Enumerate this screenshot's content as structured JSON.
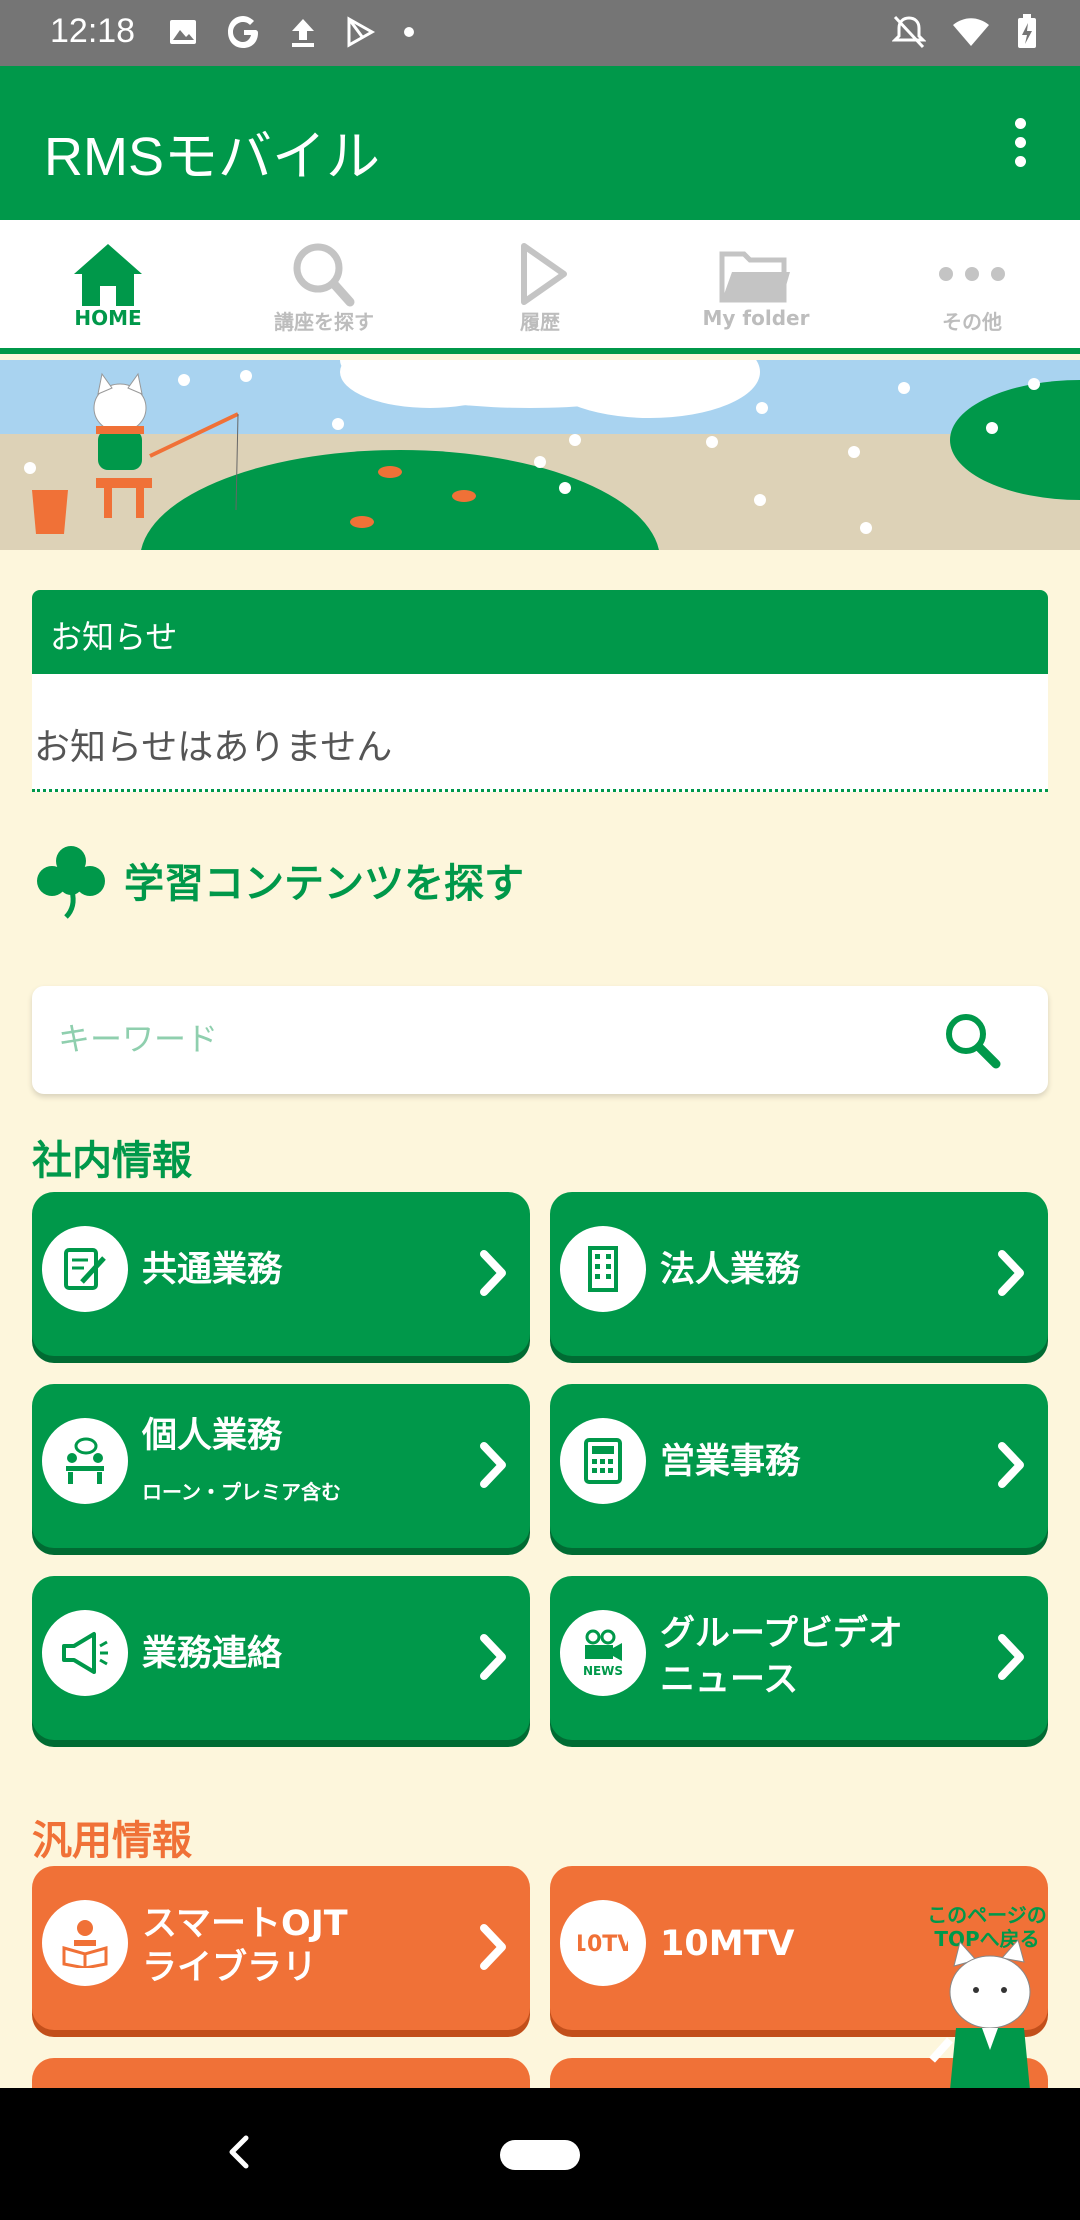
{
  "status_bar": {
    "time": "12:18",
    "icons_left": [
      "image-icon",
      "google-icon",
      "upload-icon",
      "play-store-icon",
      "dot-icon"
    ],
    "icons_right": [
      "bell-off-icon",
      "wifi-icon",
      "battery-icon"
    ]
  },
  "app_bar": {
    "title": "RMSモバイル"
  },
  "tabs": [
    {
      "label": "HOME",
      "icon": "home-icon",
      "active": true
    },
    {
      "label": "講座を探す",
      "icon": "search-icon",
      "active": false
    },
    {
      "label": "履歴",
      "icon": "play-icon",
      "active": false
    },
    {
      "label": "My folder",
      "icon": "folder-icon",
      "active": false
    },
    {
      "label": "その他",
      "icon": "more-icon",
      "active": false
    }
  ],
  "notice": {
    "title": "お知らせ",
    "message": "お知らせはありません"
  },
  "search_section": {
    "title": "学習コンテンツを探す",
    "placeholder": "キーワード"
  },
  "internal": {
    "label": "社内情報",
    "tiles": [
      {
        "line1": "共通業務",
        "icon": "document-edit-icon"
      },
      {
        "line1": "法人業務",
        "icon": "building-icon"
      },
      {
        "line1": "個人業務",
        "sub": "ローン・プレミア含む",
        "icon": "people-meeting-icon"
      },
      {
        "line1": "営業事務",
        "icon": "calculator-icon"
      },
      {
        "line1": "業務連絡",
        "icon": "megaphone-icon"
      },
      {
        "line1": "グループビデオ",
        "line2": "ニュース",
        "icon": "video-news-icon",
        "icon_text": "NEWS"
      }
    ]
  },
  "general": {
    "label": "汎用情報",
    "tiles": [
      {
        "line1": "スマートOJT",
        "line2": "ライブラリ",
        "icon": "reading-person-icon"
      },
      {
        "line1": "10MTV",
        "icon": "10mtv-logo-icon",
        "icon_text": "10TV"
      }
    ]
  },
  "back_to_top": {
    "line1": "このページの",
    "line2": "TOPへ戻る"
  },
  "colors": {
    "primary": "#00984a",
    "accent": "#f07137",
    "background": "#fdf6dc"
  }
}
